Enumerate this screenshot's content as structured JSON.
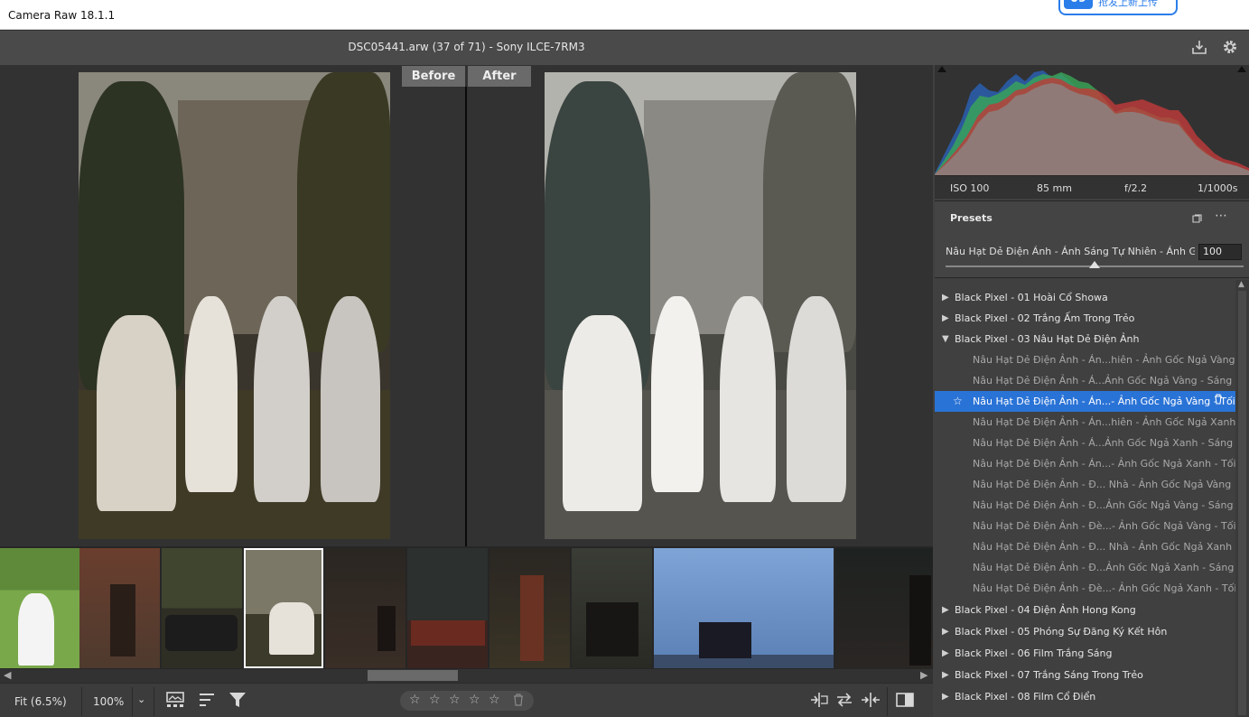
{
  "app": {
    "title": "Camera Raw 18.1.1",
    "badge_num": "09",
    "badge_text": "抢发上新上传"
  },
  "header": {
    "filename": "DSC05441.arw (37 of 71)  -  Sony ILCE-7RM3"
  },
  "viewer": {
    "before_label": "Before",
    "after_label": "After"
  },
  "exif": {
    "iso": "ISO 100",
    "focal": "85 mm",
    "aperture": "f/2.2",
    "shutter": "1/1000s"
  },
  "presets": {
    "title": "Presets",
    "amount_label": "Nâu Hạt Dẻ Điện Ảnh - Ánh Sáng Tự Nhiên - Ảnh Gốc Ngả",
    "amount_value": "100",
    "amount_fraction": 0.5,
    "rows": [
      {
        "label": "Black Pixel - 01 Hoài Cổ Showa",
        "kind": "group",
        "open": false
      },
      {
        "label": "Black Pixel - 02 Trắng Ấm Trong Trẻo",
        "kind": "group",
        "open": false
      },
      {
        "label": "Black Pixel - 03 Nâu Hạt Dẻ Điện Ảnh",
        "kind": "group",
        "open": true
      },
      {
        "label": "Nâu Hạt Dẻ Điện Ảnh - Án...hiên - Ảnh Gốc Ngả Vàng",
        "kind": "item"
      },
      {
        "label": "Nâu Hạt Dẻ Điện Ảnh - Á...Ảnh Gốc Ngả Vàng - Sáng",
        "kind": "item"
      },
      {
        "label": "Nâu Hạt Dẻ Điện Ảnh - Án...- Ảnh Gốc Ngả Vàng - Tối",
        "kind": "item",
        "active": true
      },
      {
        "label": "Nâu Hạt Dẻ Điện Ảnh - Án...hiên - Ảnh Gốc Ngả Xanh",
        "kind": "item"
      },
      {
        "label": "Nâu Hạt Dẻ Điện Ảnh - Á...Ảnh Gốc Ngả Xanh - Sáng",
        "kind": "item"
      },
      {
        "label": "Nâu Hạt Dẻ Điện Ảnh - Án...- Ảnh Gốc Ngả Xanh - Tối",
        "kind": "item"
      },
      {
        "label": "Nâu Hạt Dẻ Điện Ảnh - Đ... Nhà - Ảnh Gốc Ngả Vàng",
        "kind": "item"
      },
      {
        "label": "Nâu Hạt Dẻ Điện Ảnh - Đ...Ảnh Gốc Ngả Vàng - Sáng",
        "kind": "item"
      },
      {
        "label": "Nâu Hạt Dẻ Điện Ảnh - Đè...- Ảnh Gốc Ngả Vàng - Tối",
        "kind": "item"
      },
      {
        "label": "Nâu Hạt Dẻ Điện Ảnh - Đ... Nhà - Ảnh Gốc Ngả Xanh",
        "kind": "item"
      },
      {
        "label": "Nâu Hạt Dẻ Điện Ảnh - Đ...Ảnh Gốc Ngả Xanh - Sáng",
        "kind": "item"
      },
      {
        "label": "Nâu Hạt Dẻ Điện Ảnh - Đè...- Ảnh Gốc Ngả Xanh - Tối",
        "kind": "item"
      },
      {
        "label": "Black Pixel - 04 Điện Ảnh Hong Kong",
        "kind": "group",
        "open": false
      },
      {
        "label": "Black Pixel - 05 Phóng Sự Đăng Ký Kết Hôn",
        "kind": "group",
        "open": false
      },
      {
        "label": "Black Pixel - 06 Film Trắng Sáng",
        "kind": "group",
        "open": false
      },
      {
        "label": "Black Pixel - 07 Trắng Sáng Trong Trẻo",
        "kind": "group",
        "open": false
      },
      {
        "label": "Black Pixel - 08 Film Cổ Điển",
        "kind": "group",
        "open": false
      }
    ]
  },
  "bottombar": {
    "fit_label": "Fit (6.5%)",
    "zoom_label": "100%"
  },
  "filmstrip": {
    "selected_index": 3,
    "count_visible": 11
  },
  "colors": {
    "accent": "#2a73d6",
    "panel": "#404040",
    "bg": "#323232"
  }
}
